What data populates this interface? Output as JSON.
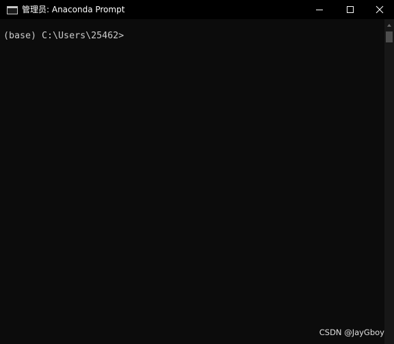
{
  "window": {
    "title": "管理员: Anaconda Prompt",
    "controls": {
      "minimize": "minimize",
      "maximize": "maximize",
      "close": "close"
    }
  },
  "terminal": {
    "prompt": "(base) C:\\Users\\25462>"
  },
  "watermark": {
    "text": "CSDN @JayGboy"
  },
  "colors": {
    "background": "#0c0c0c",
    "titlebar": "#000000",
    "text": "#cccccc",
    "scrollbar": "#171717",
    "scroll_thumb": "#4d4d4d"
  }
}
